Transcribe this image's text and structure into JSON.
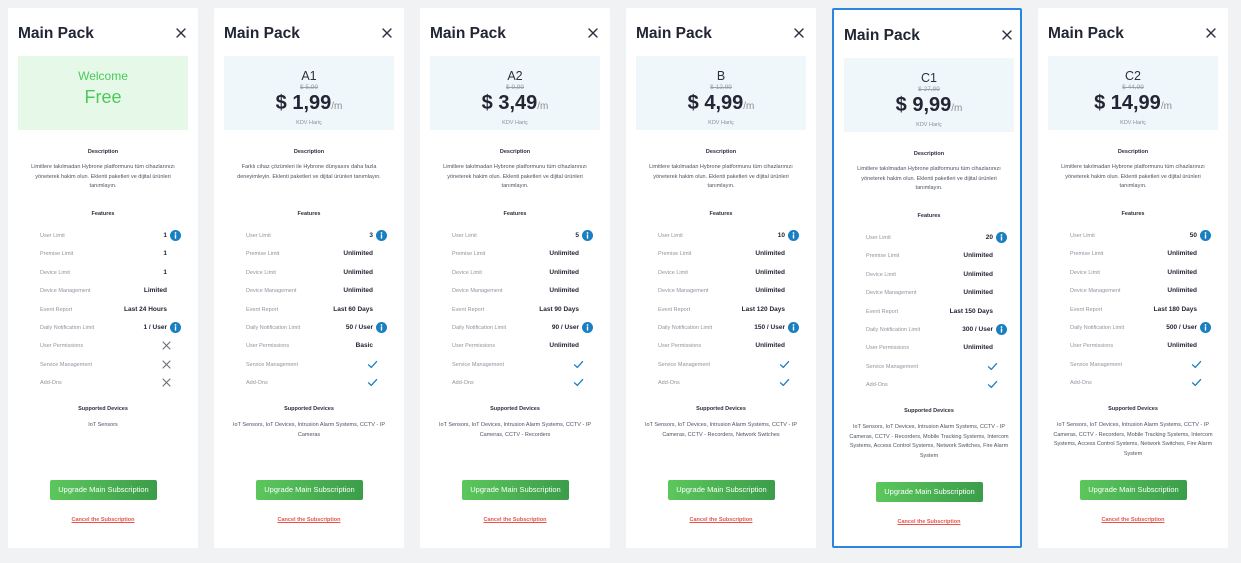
{
  "plans": [
    {
      "title": "Main Pack",
      "is_free": true,
      "welcome": "Welcome",
      "free_label": "Free",
      "description_title": "Description",
      "description": "Limitlere takılmadan Hybrone platformunu tüm cihazlarınızı yöneterek hakim olun. Eklenti paketleri ve dijital ürünleri tanımlayın.",
      "features_title": "Features",
      "features": [
        {
          "label": "User Limit",
          "value": "1",
          "info": true
        },
        {
          "label": "Premise Limit",
          "value": "1"
        },
        {
          "label": "Device Limit",
          "value": "1"
        },
        {
          "label": "Device Management",
          "value": "Limited"
        },
        {
          "label": "Event Report",
          "value": "Last 24 Hours"
        },
        {
          "label": "Daily Notification Limit",
          "value": "1 / User",
          "info": true
        },
        {
          "label": "User Permissions",
          "icon": "cross-icon"
        },
        {
          "label": "Service Management",
          "icon": "cross-icon"
        },
        {
          "label": "Add-Ons",
          "icon": "cross-icon"
        }
      ],
      "devices_title": "Supported Devices",
      "devices": "IoT Sensors",
      "upgrade_label": "Upgrade Main Subscription",
      "cancel_label": "Cancel the Subscription"
    },
    {
      "title": "Main Pack",
      "name": "A1",
      "old_price": "$ 5,99",
      "price": "$ 1,99",
      "unit": "/m",
      "tax": "KDV Hariç",
      "description_title": "Description",
      "description": "Farklı cihaz çözümleri ile Hybrone dünyasını daha fazla deneyimleyin. Eklenti paketleri ve dijital ürünleri tanımlayın.",
      "features_title": "Features",
      "features": [
        {
          "label": "User Limit",
          "value": "3",
          "info": true
        },
        {
          "label": "Premise Limit",
          "value": "Unlimited"
        },
        {
          "label": "Device Limit",
          "value": "Unlimited"
        },
        {
          "label": "Device Management",
          "value": "Unlimited"
        },
        {
          "label": "Event Report",
          "value": "Last 60 Days"
        },
        {
          "label": "Daily Notification Limit",
          "value": "50 / User",
          "info": true
        },
        {
          "label": "User Permissions",
          "value": "Basic"
        },
        {
          "label": "Service Management",
          "icon": "check-icon"
        },
        {
          "label": "Add-Ons",
          "icon": "check-icon"
        }
      ],
      "devices_title": "Supported Devices",
      "devices": "IoT Sensors, IoT Devices, Intrusion Alarm Systems, CCTV - IP Cameras",
      "upgrade_label": "Upgrade Main Subscription",
      "cancel_label": "Cancel the Subscription"
    },
    {
      "title": "Main Pack",
      "name": "A2",
      "old_price": "$ 9,99",
      "price": "$ 3,49",
      "unit": "/m",
      "tax": "KDV Hariç",
      "description_title": "Description",
      "description": "Limitlere takılmadan Hybrone platformunu tüm cihazlarınızı yöneterek hakim olun. Eklenti paketleri ve dijital ürünleri tanımlayın.",
      "features_title": "Features",
      "features": [
        {
          "label": "User Limit",
          "value": "5",
          "info": true
        },
        {
          "label": "Premise Limit",
          "value": "Unlimited"
        },
        {
          "label": "Device Limit",
          "value": "Unlimited"
        },
        {
          "label": "Device Management",
          "value": "Unlimited"
        },
        {
          "label": "Event Report",
          "value": "Last 90 Days"
        },
        {
          "label": "Daily Notification Limit",
          "value": "90 / User",
          "info": true
        },
        {
          "label": "User Permissions",
          "value": "Unlimited"
        },
        {
          "label": "Service Management",
          "icon": "check-icon"
        },
        {
          "label": "Add-Ons",
          "icon": "check-icon"
        }
      ],
      "devices_title": "Supported Devices",
      "devices": "IoT Sensors, IoT Devices, Intrusion Alarm Systems, CCTV - IP Cameras, CCTV - Recorders",
      "upgrade_label": "Upgrade Main Subscription",
      "cancel_label": "Cancel the Subscription"
    },
    {
      "title": "Main Pack",
      "name": "B",
      "old_price": "$ 12,99",
      "price": "$ 4,99",
      "unit": "/m",
      "tax": "KDV Hariç",
      "description_title": "Description",
      "description": "Limitlere takılmadan Hybrone platformunu tüm cihazlarınızı yöneterek hakim olun. Eklenti paketleri ve dijital ürünleri tanımlayın.",
      "features_title": "Features",
      "features": [
        {
          "label": "User Limit",
          "value": "10",
          "info": true
        },
        {
          "label": "Premise Limit",
          "value": "Unlimited"
        },
        {
          "label": "Device Limit",
          "value": "Unlimited"
        },
        {
          "label": "Device Management",
          "value": "Unlimited"
        },
        {
          "label": "Event Report",
          "value": "Last 120 Days"
        },
        {
          "label": "Daily Notification Limit",
          "value": "150 / User",
          "info": true
        },
        {
          "label": "User Permissions",
          "value": "Unlimited"
        },
        {
          "label": "Service Management",
          "icon": "check-icon"
        },
        {
          "label": "Add-Ons",
          "icon": "check-icon"
        }
      ],
      "devices_title": "Supported Devices",
      "devices": "IoT Sensors, IoT Devices, Intrusion Alarm Systems, CCTV - IP Cameras, CCTV - Recorders, Network Switches",
      "upgrade_label": "Upgrade Main Subscription",
      "cancel_label": "Cancel the Subscription"
    },
    {
      "title": "Main Pack",
      "name": "C1",
      "selected": true,
      "old_price": "$ 27,99",
      "price": "$ 9,99",
      "unit": "/m",
      "tax": "KDV Hariç",
      "description_title": "Description",
      "description": "Limitlere takılmadan Hybrone platformunu tüm cihazlarınızı yöneterek hakim olun. Eklenti paketleri ve dijital ürünleri tanımlayın.",
      "features_title": "Features",
      "features": [
        {
          "label": "User Limit",
          "value": "20",
          "info": true
        },
        {
          "label": "Premise Limit",
          "value": "Unlimited"
        },
        {
          "label": "Device Limit",
          "value": "Unlimited"
        },
        {
          "label": "Device Management",
          "value": "Unlimited"
        },
        {
          "label": "Event Report",
          "value": "Last 150 Days"
        },
        {
          "label": "Daily Notification Limit",
          "value": "300 / User",
          "info": true
        },
        {
          "label": "User Permissions",
          "value": "Unlimited"
        },
        {
          "label": "Service Management",
          "icon": "check-icon"
        },
        {
          "label": "Add-Ons",
          "icon": "check-icon"
        }
      ],
      "devices_title": "Supported Devices",
      "devices": "IoT Sensors, IoT Devices, Intrusion Alarm Systems, CCTV - IP Cameras, CCTV - Recorders, Mobile Tracking Systems, Intercom Systems, Access Control Systems, Network Switches, Fire Alarm System",
      "upgrade_label": "Upgrade Main Subscription",
      "cancel_label": "Cancel the Subscription"
    },
    {
      "title": "Main Pack",
      "name": "C2",
      "old_price": "$ 44,99",
      "price": "$ 14,99",
      "unit": "/m",
      "tax": "KDV Hariç",
      "description_title": "Description",
      "description": "Limitlere takılmadan Hybrone platformunu tüm cihazlarınızı yöneterek hakim olun. Eklenti paketleri ve dijital ürünleri tanımlayın.",
      "features_title": "Features",
      "features": [
        {
          "label": "User Limit",
          "value": "50",
          "info": true
        },
        {
          "label": "Premise Limit",
          "value": "Unlimited"
        },
        {
          "label": "Device Limit",
          "value": "Unlimited"
        },
        {
          "label": "Device Management",
          "value": "Unlimited"
        },
        {
          "label": "Event Report",
          "value": "Last 180 Days"
        },
        {
          "label": "Daily Notification Limit",
          "value": "500 / User",
          "info": true
        },
        {
          "label": "User Permissions",
          "value": "Unlimited"
        },
        {
          "label": "Service Management",
          "icon": "check-icon"
        },
        {
          "label": "Add-Ons",
          "icon": "check-icon"
        }
      ],
      "devices_title": "Supported Devices",
      "devices": "IoT Sensors, IoT Devices, Intrusion Alarm Systems, CCTV - IP Cameras, CCTV - Recorders, Mobile Tracking Systems, Intercom Systems, Access Control Systems, Network Switches, Fire Alarm System",
      "upgrade_label": "Upgrade Main Subscription",
      "cancel_label": "Cancel the Subscription"
    }
  ],
  "colors": {
    "accent_blue": "#1a7fc1",
    "selected_border": "#2a86e0",
    "free_green": "#4bc95b",
    "button_green": "#4cb451",
    "cancel_red": "#e6544a"
  }
}
